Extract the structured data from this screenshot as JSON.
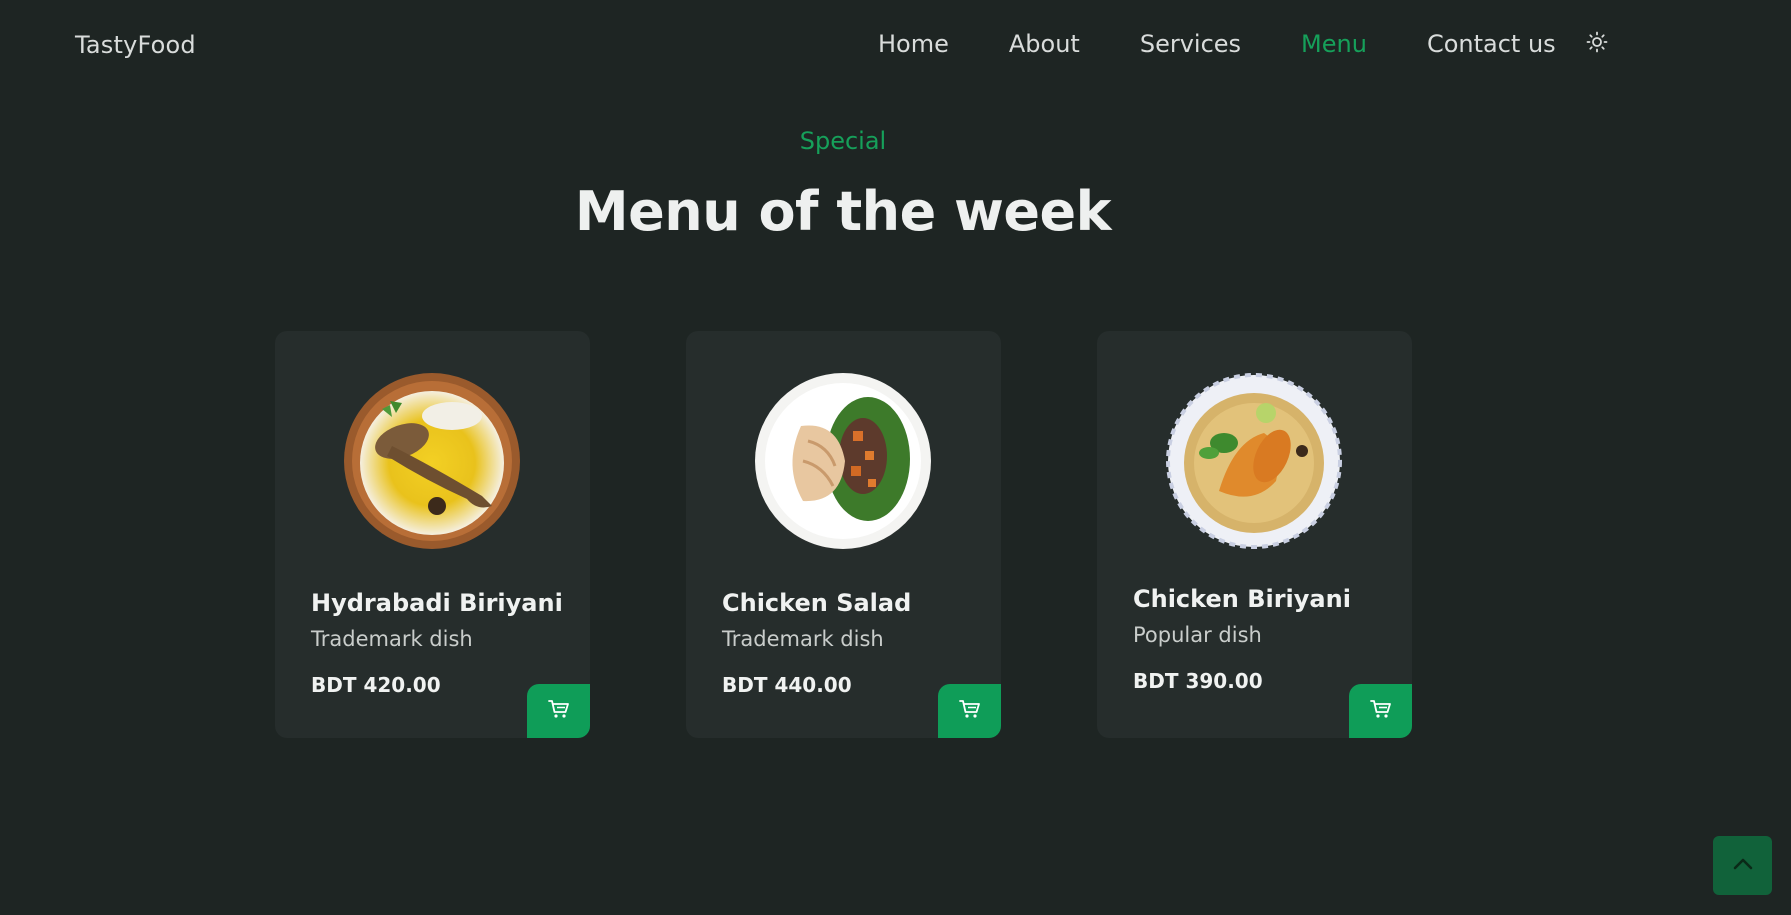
{
  "header": {
    "logo": "TastyFood",
    "nav": [
      {
        "label": "Home"
      },
      {
        "label": "About"
      },
      {
        "label": "Services"
      },
      {
        "label": "Menu",
        "active": true
      },
      {
        "label": "Contact us"
      }
    ],
    "theme_icon": "sun-icon"
  },
  "section": {
    "eyebrow": "Special",
    "title": "Menu of the week"
  },
  "cards": [
    {
      "name": "Hydrabadi Biriyani",
      "description": "Trademark dish",
      "price": "BDT 420.00",
      "image": "biryani-plate-icon"
    },
    {
      "name": "Chicken Salad",
      "description": "Trademark dish",
      "price": "BDT 440.00",
      "image": "salad-plate-icon"
    },
    {
      "name": "Chicken Biriyani",
      "description": "Popular dish",
      "price": "BDT 390.00",
      "image": "biryani-bowl-icon"
    }
  ],
  "cart_icon": "cart-icon",
  "scroll_top_icon": "chevron-up-icon",
  "colors": {
    "background": "#1e2523",
    "card": "#262d2c",
    "accent": "#16a05a",
    "button": "#0f9d58"
  }
}
